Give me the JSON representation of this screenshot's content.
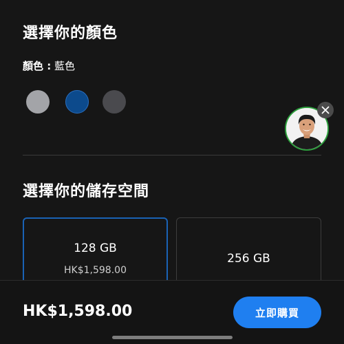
{
  "color_section": {
    "title": "選擇你的顏色",
    "label_key": "顏色 :",
    "label_value": "藍色",
    "swatches": [
      {
        "name": "silver",
        "color": "#a3a4a8",
        "selected": false
      },
      {
        "name": "blue",
        "color": "#0c4a8c",
        "selected": true
      },
      {
        "name": "graphite",
        "color": "#4a4a4e",
        "selected": false
      }
    ]
  },
  "storage_section": {
    "title": "選擇你的儲存空間",
    "options": [
      {
        "capacity": "128 GB",
        "price": "HK$1,598.00",
        "selected": true
      },
      {
        "capacity": "256 GB",
        "price": "",
        "selected": false
      }
    ]
  },
  "footer": {
    "total": "HK$1,598.00",
    "buy_label": "立即購買"
  },
  "icons": {
    "close": "close-icon",
    "avatar": "person-avatar"
  },
  "colors": {
    "background": "#161616",
    "accent": "#1f7ff0",
    "selected_border": "#1a63b6",
    "avatar_ring": "#2c9f3c"
  }
}
